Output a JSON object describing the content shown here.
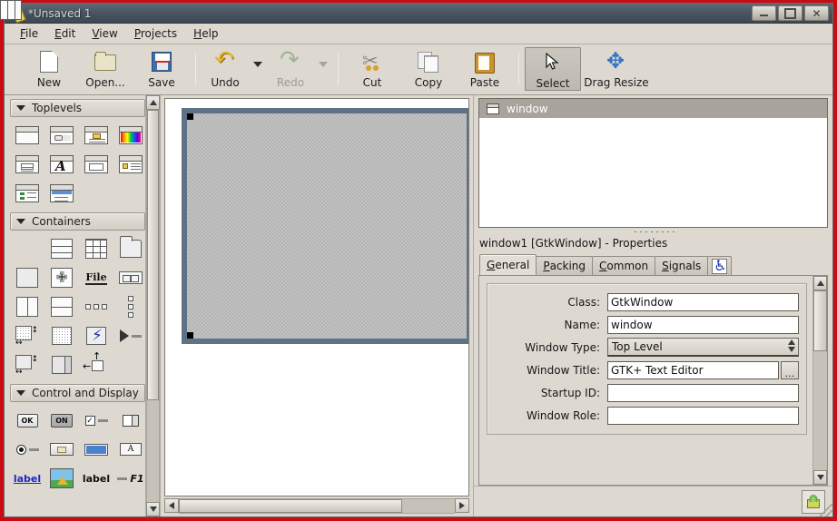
{
  "window": {
    "title": "*Unsaved 1",
    "app_icon": "glade-app-icon",
    "controls": {
      "minimize": "minimize-button",
      "maximize": "maximize-button",
      "close": "close-button"
    }
  },
  "menubar": {
    "items": [
      {
        "label": "File",
        "mnemonic": "F"
      },
      {
        "label": "Edit",
        "mnemonic": "E"
      },
      {
        "label": "View",
        "mnemonic": "V"
      },
      {
        "label": "Projects",
        "mnemonic": "P"
      },
      {
        "label": "Help",
        "mnemonic": "H"
      }
    ]
  },
  "toolbar": {
    "items": [
      {
        "label": "New",
        "icon": "new-file-icon",
        "enabled": true,
        "has_dropdown": false,
        "pressed": false
      },
      {
        "label": "Open...",
        "icon": "open-folder-icon",
        "enabled": true,
        "has_dropdown": false,
        "pressed": false
      },
      {
        "label": "Save",
        "icon": "save-floppy-icon",
        "enabled": true,
        "has_dropdown": false,
        "pressed": false
      },
      {
        "label": "Undo",
        "icon": "undo-arrow-icon",
        "enabled": true,
        "has_dropdown": true,
        "pressed": false
      },
      {
        "label": "Redo",
        "icon": "redo-arrow-icon",
        "enabled": false,
        "has_dropdown": true,
        "pressed": false
      },
      {
        "label": "Cut",
        "icon": "scissors-icon",
        "enabled": true,
        "has_dropdown": false,
        "pressed": false
      },
      {
        "label": "Copy",
        "icon": "copy-icon",
        "enabled": true,
        "has_dropdown": false,
        "pressed": false
      },
      {
        "label": "Paste",
        "icon": "clipboard-icon",
        "enabled": true,
        "has_dropdown": false,
        "pressed": false
      },
      {
        "label": "Select",
        "icon": "mouse-pointer-icon",
        "enabled": true,
        "has_dropdown": false,
        "pressed": true
      },
      {
        "label": "Drag Resize",
        "icon": "move-arrows-icon",
        "enabled": true,
        "has_dropdown": false,
        "pressed": false
      }
    ]
  },
  "palette": {
    "groups": [
      {
        "title": "Toplevels",
        "expanded": true,
        "widgets": [
          "window-widget-icon",
          "dialog-widget-icon",
          "message-dialog-icon",
          "color-selection-dialog-icon",
          "about-dialog-icon",
          "font-selection-dialog-icon",
          "input-dialog-icon",
          "assistant-icon",
          "recent-chooser-dialog-icon",
          "file-chooser-dialog-icon"
        ]
      },
      {
        "title": "Containers",
        "expanded": true,
        "widgets": [
          "horizontal-box-icon",
          "vertical-box-icon",
          "table-grid-icon",
          "notebook-icon",
          "frame-icon",
          "alignment-icon",
          "fixed-container-icon",
          "horizontal-button-box-icon",
          "horizontal-paned-icon",
          "vertical-paned-icon",
          "vertical-button-box-icon",
          "vertical-dots-icon",
          "scrolled-window-icon",
          "viewport-icon",
          "event-box-icon",
          "expander-icon",
          "handle-box-icon",
          "layout-icon",
          "offscreen-window-icon"
        ]
      },
      {
        "title": "Control and Display",
        "expanded": true,
        "widgets": [
          "button-ok-icon",
          "toggle-button-on-icon",
          "check-button-icon",
          "spin-button-icon",
          "radio-button-icon",
          "file-chooser-button-icon",
          "progress-bar-icon",
          "font-button-icon",
          "link-button-icon",
          "image-icon",
          "label-icon",
          "accel-label-icon"
        ],
        "labels": {
          "button": "OK",
          "toggle": "ON",
          "link": "label",
          "label": "label",
          "accel": "F1",
          "fixed": "File",
          "font": "A"
        }
      }
    ]
  },
  "canvas": {
    "selected_widget": "window1",
    "design_window_label": ""
  },
  "widget_tree": {
    "rows": [
      {
        "label": "window",
        "icon": "window-tree-icon",
        "selected": true
      }
    ]
  },
  "properties": {
    "title": "window1 [GtkWindow] - Properties",
    "tabs": [
      {
        "label": "General",
        "mnemonic": "G",
        "active": true
      },
      {
        "label": "Packing",
        "mnemonic": "P",
        "active": false
      },
      {
        "label": "Common",
        "mnemonic": "C",
        "active": false
      },
      {
        "label": "Signals",
        "mnemonic": "S",
        "active": false
      }
    ],
    "a11y_tab_icon": "accessibility-icon",
    "fields": [
      {
        "label": "Class:",
        "value": "GtkWindow",
        "type": "text",
        "editable": false
      },
      {
        "label": "Name:",
        "value": "window",
        "type": "text",
        "editable": true
      },
      {
        "label": "Window Type:",
        "value": "Top Level",
        "type": "combo",
        "editable": true
      },
      {
        "label": "Window Title:",
        "value": "GTK+ Text Editor",
        "type": "text-with-button",
        "editable": true,
        "button_label": "..."
      },
      {
        "label": "Startup ID:",
        "value": "",
        "type": "text",
        "editable": true
      },
      {
        "label": "Window Role:",
        "value": "",
        "type": "text",
        "editable": true
      }
    ]
  },
  "statusbar": {
    "lock_icon": "lock-icon",
    "resize_grip": "resize-grip-icon"
  },
  "colors": {
    "frame_red": "#c90b13",
    "titlebar": "#4a5560",
    "chrome": "#ddd9d1",
    "selection_border": "#5d7285",
    "tree_selection": "#a8a49c",
    "accent_blue": "#3f6ea8"
  }
}
